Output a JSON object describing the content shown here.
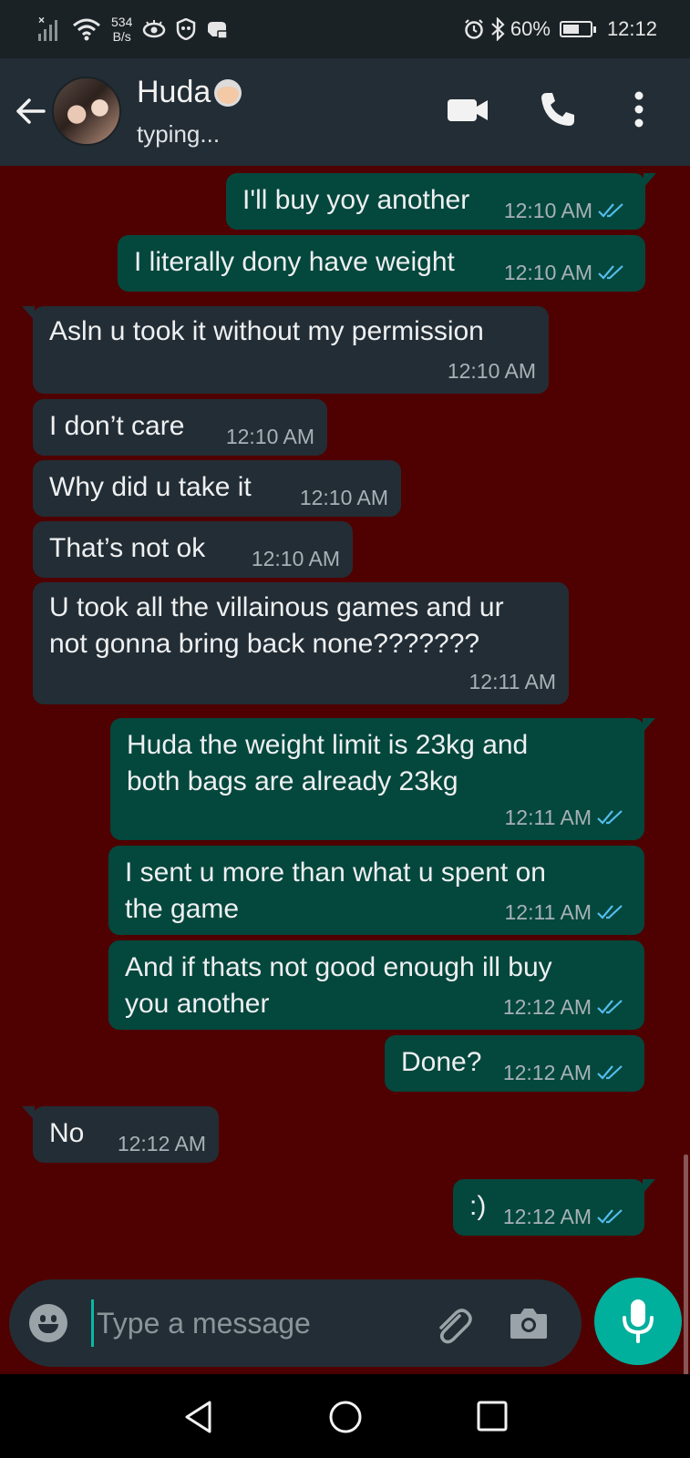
{
  "status_bar": {
    "net_speed_value": "534",
    "net_speed_unit": "B/s",
    "battery": "60%",
    "battery_level": 0.6,
    "time": "12:12"
  },
  "header": {
    "contact_name": "Huda",
    "status": "typing..."
  },
  "messages": [
    {
      "dir": "out",
      "text": "I'll buy yoy another",
      "time": "12:10 AM"
    },
    {
      "dir": "out",
      "text": "I literally dony have weight",
      "time": "12:10 AM"
    },
    {
      "dir": "in",
      "text": "Asln u took it without my permission",
      "time": "12:10 AM"
    },
    {
      "dir": "in",
      "text": "I don’t care",
      "time": "12:10 AM"
    },
    {
      "dir": "in",
      "text": "Why did u take it",
      "time": "12:10 AM"
    },
    {
      "dir": "in",
      "text": "That’s not ok",
      "time": "12:10 AM"
    },
    {
      "dir": "in",
      "text": "U took all the villainous games and ur\nnot gonna bring back none???????",
      "time": "12:11 AM"
    },
    {
      "dir": "out",
      "text": "Huda the weight limit is 23kg and\nboth bags are already 23kg",
      "time": "12:11 AM"
    },
    {
      "dir": "out",
      "text": "I sent u more than what u spent on\nthe game",
      "time": "12:11 AM"
    },
    {
      "dir": "out",
      "text": "And if thats not good enough ill buy\nyou another",
      "time": "12:12 AM"
    },
    {
      "dir": "out",
      "text": "Done?",
      "time": "12:12 AM"
    },
    {
      "dir": "in",
      "text": "No",
      "time": "12:12 AM"
    },
    {
      "dir": "out",
      "text": ":)",
      "time": "12:12 AM"
    }
  ],
  "composer": {
    "placeholder": "Type a message"
  },
  "colors": {
    "chat_background": "#4f0000",
    "outgoing_bubble": "#04473d",
    "incoming_bubble": "#232d35",
    "read_ticks": "#53bdeb",
    "mic_button": "#00af9c"
  }
}
